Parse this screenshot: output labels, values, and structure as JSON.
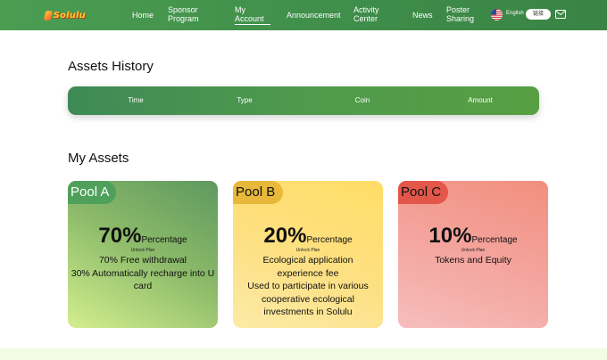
{
  "brand": {
    "logo_text": "Solulu"
  },
  "nav": {
    "items": [
      {
        "label": "Home"
      },
      {
        "label": "Sponsor\nProgram"
      },
      {
        "label": "My\nAccount"
      },
      {
        "label": "Announcement"
      },
      {
        "label": "Activity\nCenter"
      },
      {
        "label": "News"
      },
      {
        "label": "Poster\nSharing"
      }
    ],
    "language": "English",
    "link_button": "链接"
  },
  "assets_history": {
    "title": "Assets History",
    "columns": [
      "Time",
      "Type",
      "Coin",
      "Amount"
    ]
  },
  "my_assets": {
    "title": "My Assets",
    "pools": [
      {
        "name": "Pool A",
        "percent": "70%",
        "percent_label": "Percentage",
        "unlock": "Unlock Plan",
        "description": "70% Free withdrawal\n30% Automatically recharge into U card"
      },
      {
        "name": "Pool B",
        "percent": "20%",
        "percent_label": "Percentage",
        "unlock": "Unlock Plan",
        "description": "Ecological application experience fee\nUsed to participate in various cooperative ecological investments in Solulu"
      },
      {
        "name": "Pool C",
        "percent": "10%",
        "percent_label": "Percentage",
        "unlock": "Unlock Plan",
        "description": "Tokens and Equity"
      }
    ]
  },
  "colors": {
    "nav_green": "#3f8e4a",
    "pool_a": "#4fa05a",
    "pool_b": "#e7b83a",
    "pool_c": "#e3574a"
  }
}
